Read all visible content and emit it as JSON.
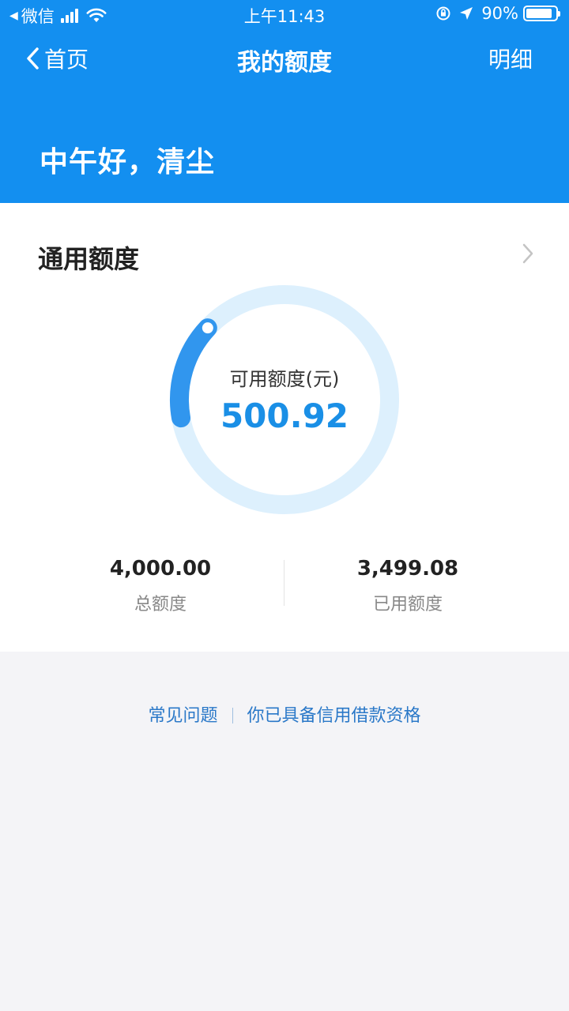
{
  "status_bar": {
    "carrier": "微信",
    "time": "上午11:43",
    "battery": "90%",
    "battery_level": 0.9
  },
  "nav": {
    "back_label": "首页",
    "title": "我的额度",
    "detail_label": "明细"
  },
  "greeting": "中午好，清尘",
  "credit": {
    "title": "通用额度",
    "available_label": "可用额度(元)",
    "available_value": "500.92",
    "total_value": "4,000.00",
    "total_label": "总额度",
    "used_value": "3,499.08",
    "used_label": "已用额度",
    "available_fraction": 0.1252
  },
  "links": {
    "faq": "常见问题",
    "eligibility": "你已具备信用借款资格"
  },
  "colors": {
    "primary": "#138ff0",
    "ring_track": "#ddf0fd",
    "ring_fill": "#3196ee",
    "value_text": "#1a8fe6"
  }
}
